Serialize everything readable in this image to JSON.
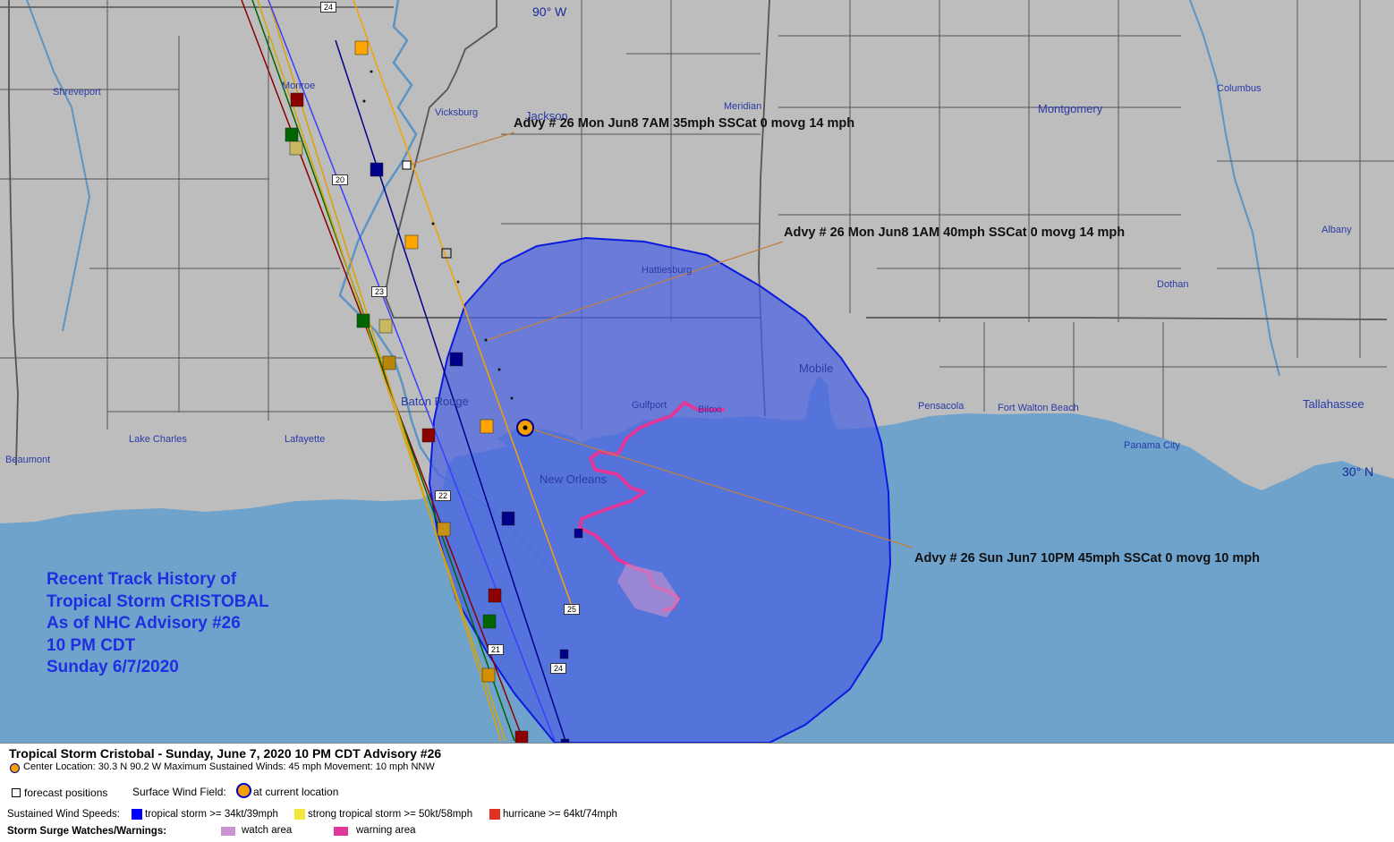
{
  "map": {
    "coords": {
      "lon_label": "90° W",
      "lat_label": "30° N"
    },
    "cities": [
      {
        "name": "Shreveport"
      },
      {
        "name": "Monroe"
      },
      {
        "name": "Vicksburg"
      },
      {
        "name": "Jackson"
      },
      {
        "name": "Meridian"
      },
      {
        "name": "Montgomery"
      },
      {
        "name": "Columbus"
      },
      {
        "name": "Albany"
      },
      {
        "name": "Dothan"
      },
      {
        "name": "Hattiesburg"
      },
      {
        "name": "Mobile"
      },
      {
        "name": "Pensacola"
      },
      {
        "name": "Fort Walton Beach"
      },
      {
        "name": "Tallahassee"
      },
      {
        "name": "Panama City"
      },
      {
        "name": "Gulfport"
      },
      {
        "name": "Biloxi"
      },
      {
        "name": "New Orleans"
      },
      {
        "name": "Baton Rouge"
      },
      {
        "name": "Lake Charles"
      },
      {
        "name": "Lafayette"
      },
      {
        "name": "Beaumont"
      }
    ],
    "road_shields": [
      "24",
      "20",
      "23",
      "22",
      "25",
      "21",
      "24"
    ],
    "advisories": [
      {
        "text": "Advy # 26 Mon Jun8 7AM  35mph SSCat 0 movg 14 mph"
      },
      {
        "text": "Advy # 26 Mon Jun8 1AM  40mph SSCat 0 movg 14 mph"
      },
      {
        "text": "Advy # 26 Sun Jun7 10PM  45mph SSCat 0 movg 10 mph"
      }
    ],
    "history_title": [
      "Recent Track History of",
      "Tropical Storm CRISTOBAL",
      "As of NHC Advisory #26",
      "10 PM CDT",
      "Sunday 6/7/2020"
    ],
    "colors": {
      "land": "#bdbdbd",
      "water": "#6fa3cc",
      "wind_field": "#4a62e0",
      "surge_watch": "#c894cf",
      "surge_warning": "#e0389a",
      "tropical_storm": "#0000ff",
      "strong_tropical_storm": "#f2e83a",
      "hurricane": "#e03020"
    },
    "storm_center": {
      "lat": 30.3,
      "lon": -90.2
    }
  },
  "legend": {
    "title": "Tropical Storm Cristobal  -  Sunday, June 7, 2020  10 PM CDT   Advisory #26",
    "center_line": "Center Location: 30.3 N  90.2 W   Maximum Sustained Winds: 45 mph   Movement: 10 mph NNW",
    "forecast_positions": "forecast positions",
    "surface_wind_field": "Surface Wind Field:",
    "at_current_location": "at current location",
    "sustained_wind_speeds": "Sustained Wind Speeds:",
    "ts_label": "tropical storm >= 34kt/39mph",
    "sts_label": "strong tropical storm >= 50kt/58mph",
    "hu_label": "hurricane >= 64kt/74mph",
    "storm_surge_label": "Storm Surge Watches/Warnings:",
    "watch_label": "watch area",
    "warning_label": "warning area"
  }
}
